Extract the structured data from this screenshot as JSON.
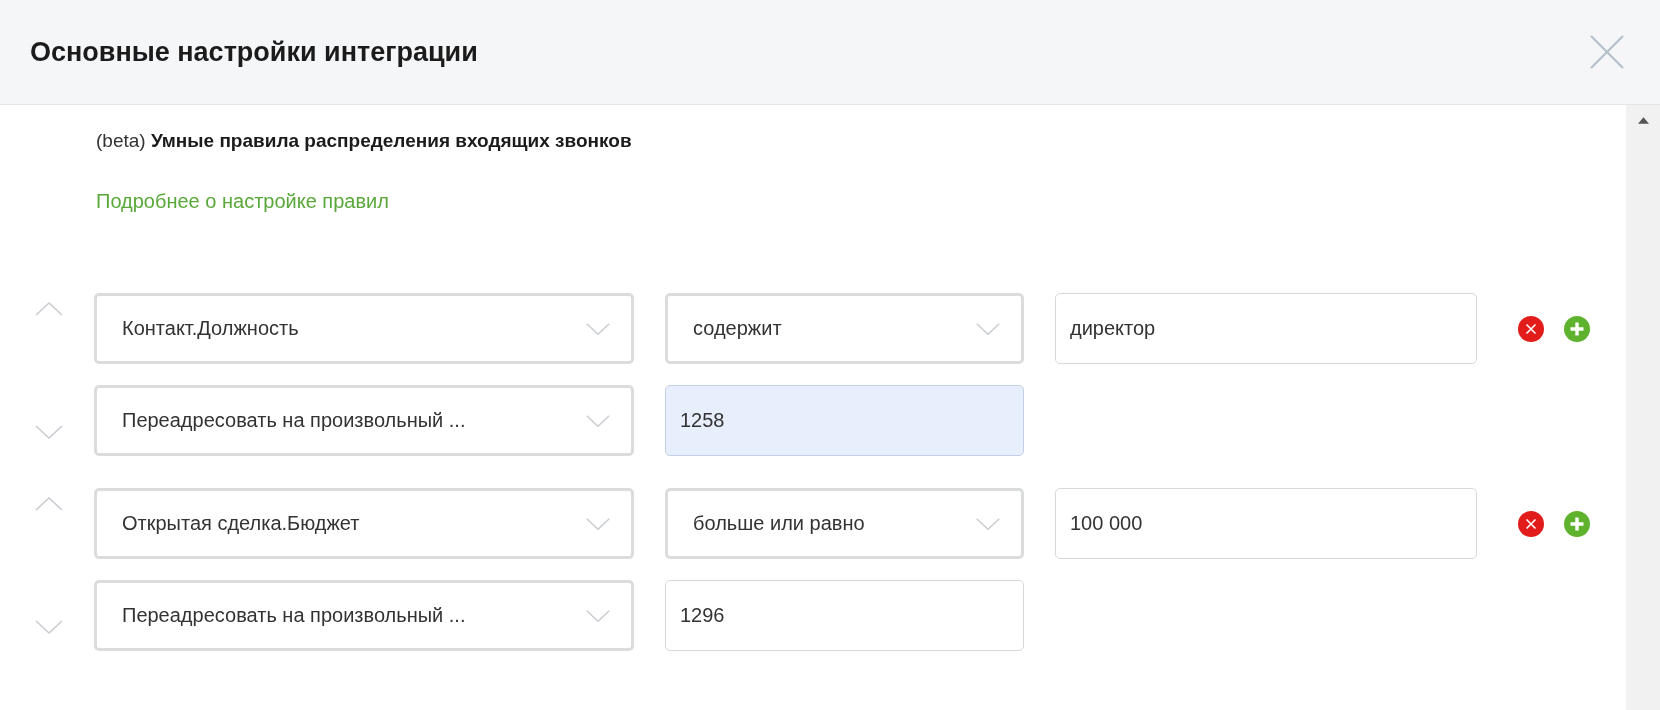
{
  "window": {
    "title": "Основные настройки интеграции"
  },
  "section": {
    "prefix": "(beta)",
    "title": "Умные правила распределения входящих звонков"
  },
  "help_link": "Подробнее о настройке правил",
  "rules": [
    {
      "condition": {
        "field": "Контакт.Должность",
        "operator": "содержит",
        "value": "директор"
      },
      "action": {
        "type": "Переадресовать на произвольный ...",
        "target": "1258",
        "focused": true
      }
    },
    {
      "condition": {
        "field": "Открытая сделка.Бюджет",
        "operator": "больше или равно",
        "value": "100 000"
      },
      "action": {
        "type": "Переадресовать на произвольный ...",
        "target": "1296",
        "focused": false
      }
    }
  ]
}
